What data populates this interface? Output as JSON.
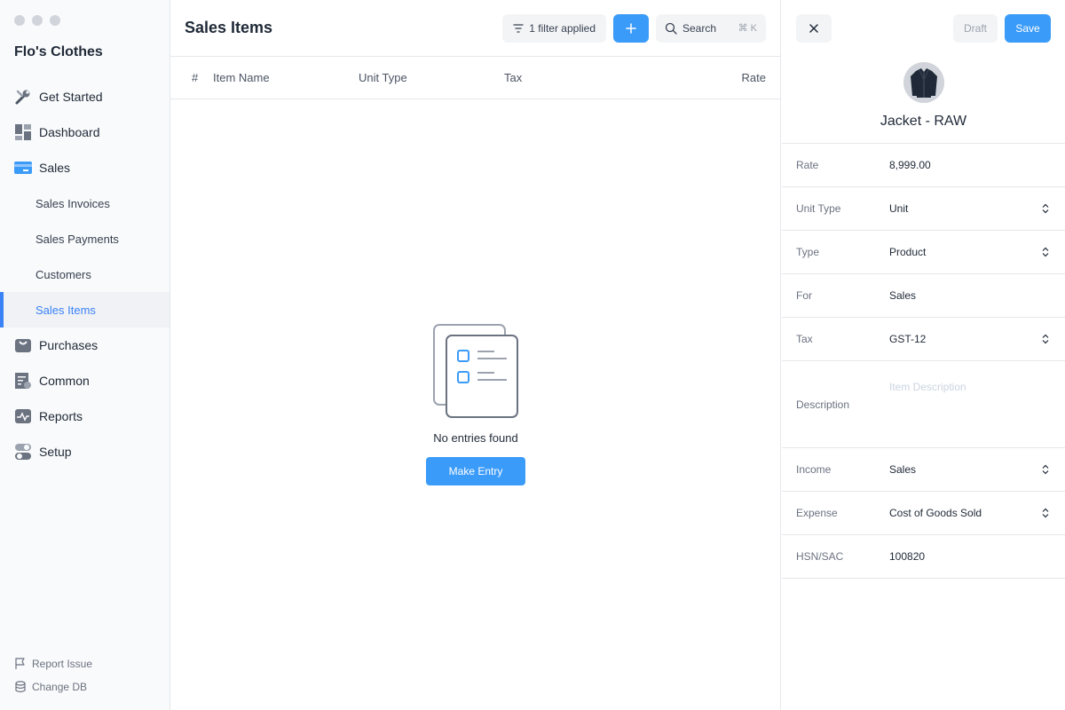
{
  "sidebar": {
    "company": "Flo's Clothes",
    "nav": [
      {
        "label": "Get Started",
        "icon": "wrench-icon"
      },
      {
        "label": "Dashboard",
        "icon": "dashboard-icon"
      },
      {
        "label": "Sales",
        "icon": "sales-card-icon"
      }
    ],
    "sales_sub": [
      "Sales Invoices",
      "Sales Payments",
      "Customers",
      "Sales Items"
    ],
    "nav_after": [
      {
        "label": "Purchases",
        "icon": "shopping-bag-icon"
      },
      {
        "label": "Common",
        "icon": "common-doc-icon"
      },
      {
        "label": "Reports",
        "icon": "reports-icon"
      },
      {
        "label": "Setup",
        "icon": "toggle-icon"
      }
    ],
    "footer": {
      "report_issue": "Report Issue",
      "change_db": "Change DB"
    }
  },
  "main": {
    "title": "Sales Items",
    "filter_label": "1 filter applied",
    "search_label": "Search",
    "search_shortcut": "⌘ K",
    "columns": [
      "#",
      "Item Name",
      "Unit Type",
      "Tax",
      "Rate"
    ],
    "empty_text": "No entries found",
    "make_entry": "Make Entry"
  },
  "panel": {
    "draft": "Draft",
    "save": "Save",
    "item_name": "Jacket - RAW",
    "fields": {
      "rate": {
        "label": "Rate",
        "value": "8,999.00"
      },
      "unit_type": {
        "label": "Unit Type",
        "value": "Unit"
      },
      "type": {
        "label": "Type",
        "value": "Product"
      },
      "for": {
        "label": "For",
        "value": "Sales"
      },
      "tax": {
        "label": "Tax",
        "value": "GST-12"
      },
      "description": {
        "label": "Description",
        "placeholder": "Item Description"
      },
      "income": {
        "label": "Income",
        "value": "Sales"
      },
      "expense": {
        "label": "Expense",
        "value": "Cost of Goods Sold"
      },
      "hsn": {
        "label": "HSN/SAC",
        "value": "100820"
      }
    }
  },
  "colors": {
    "accent": "#3b9bf8",
    "active_text": "#3b82f6",
    "sidebar_bg": "#f9fafb"
  }
}
